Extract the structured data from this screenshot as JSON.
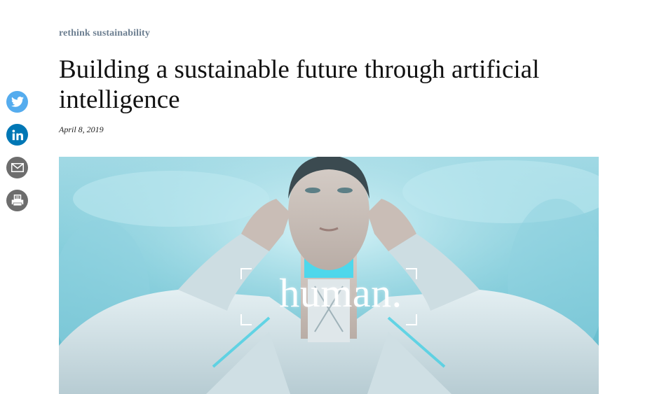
{
  "share": {
    "items": [
      {
        "icon": "twitter-icon",
        "color": "#55acee"
      },
      {
        "icon": "linkedin-icon",
        "color": "#0077b5"
      },
      {
        "icon": "mail-icon",
        "color": "#6d6d6d"
      },
      {
        "icon": "print-icon",
        "color": "#6d6d6d"
      }
    ]
  },
  "article": {
    "category": "rethink sustainability",
    "title": "Building a sustainable future through artificial intelligence",
    "date": "April 8, 2019"
  },
  "hero": {
    "caption": "human."
  },
  "colors": {
    "category_text": "#6d7f91",
    "title_text": "#111111",
    "hero_base": "#7ccad9"
  }
}
